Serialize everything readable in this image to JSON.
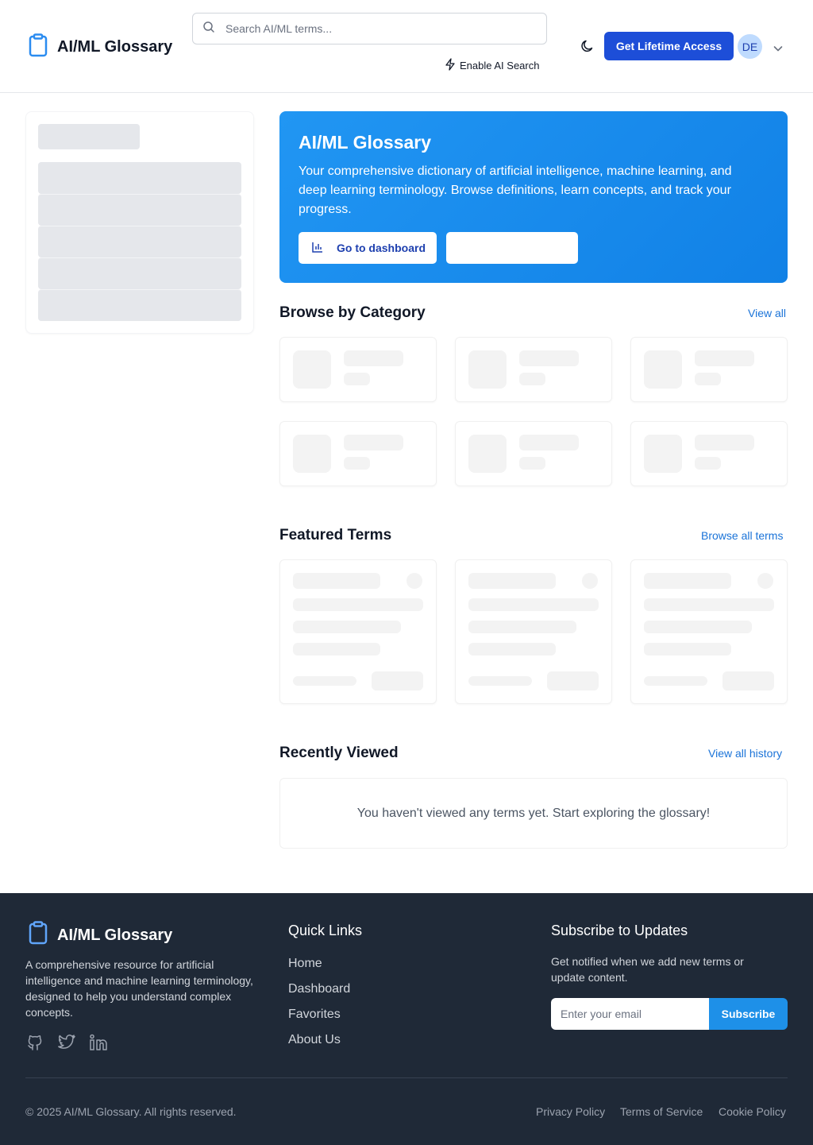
{
  "header": {
    "logo_text": "AI/ML Glossary",
    "search_placeholder": "Search AI/ML terms...",
    "ai_search_label": "Enable AI Search",
    "cta_label": "Get Lifetime Access",
    "avatar_initials": "DE",
    "accent": "#1d4ed8"
  },
  "hero": {
    "title": "AI/ML Glossary",
    "description": "Your comprehensive dictionary of artificial intelligence, machine learning, and deep learning terminology. Browse definitions, learn concepts, and track your progress.",
    "dashboard_button": "Go to dashboard",
    "secondary_button": ""
  },
  "sections": {
    "categories": {
      "title": "Browse by Category",
      "link": "View all"
    },
    "featured": {
      "title": "Featured Terms",
      "link": "Browse all terms"
    },
    "recent": {
      "title": "Recently Viewed",
      "link": "View all history",
      "empty_message": "You haven't viewed any terms yet. Start exploring the glossary!"
    }
  },
  "footer": {
    "logo_text": "AI/ML Glossary",
    "description": "A comprehensive resource for artificial intelligence and machine learning terminology, designed to help you understand complex concepts.",
    "social_icons": [
      "github-icon",
      "twitter-icon",
      "linkedin-icon"
    ],
    "quick_links_title": "Quick Links",
    "quick_links": [
      "Home",
      "Dashboard",
      "Favorites",
      "About Us"
    ],
    "subscribe_title": "Subscribe to Updates",
    "subscribe_desc": "Get notified when we add new terms or update content.",
    "email_placeholder": "Enter your email",
    "subscribe_button": "Subscribe",
    "copyright": "© 2025 AI/ML Glossary. All rights reserved.",
    "legal_links": [
      "Privacy Policy",
      "Terms of Service",
      "Cookie Policy"
    ]
  }
}
